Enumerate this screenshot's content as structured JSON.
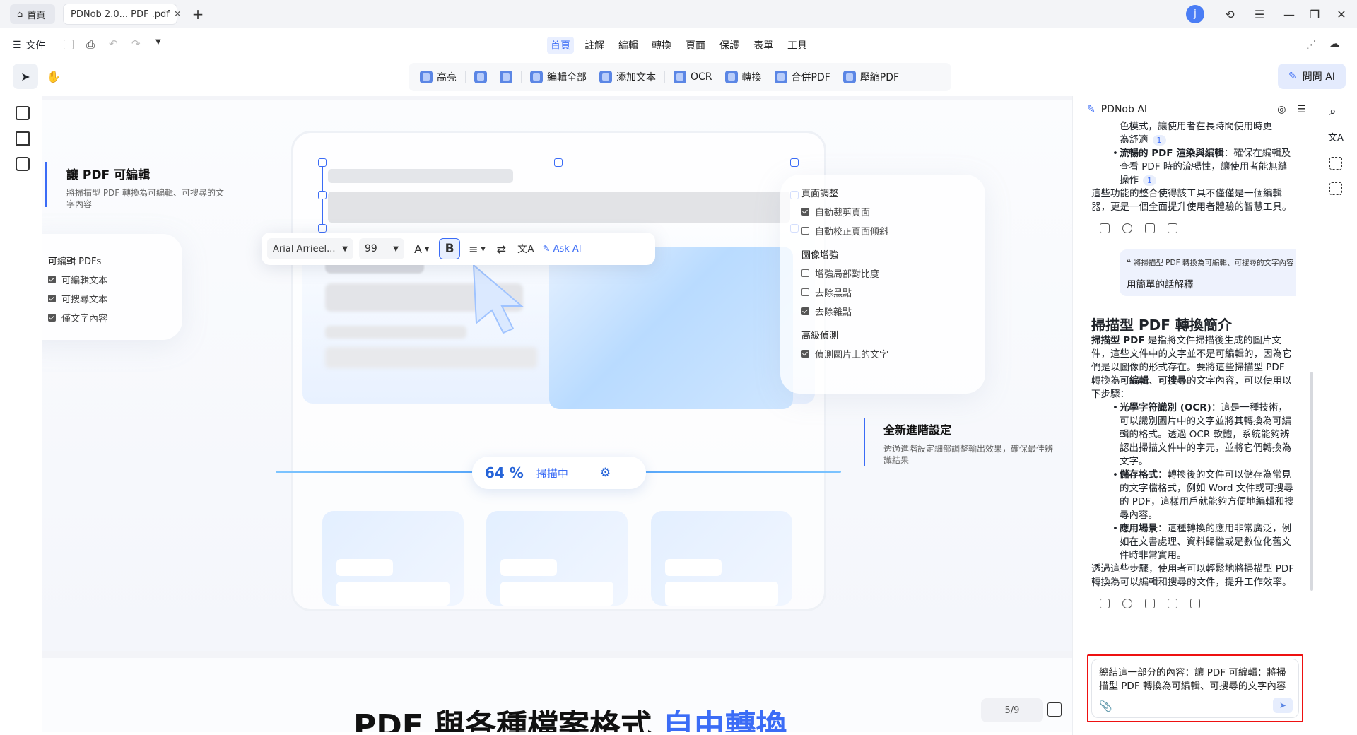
{
  "tabs": {
    "home_label": "首頁",
    "doc_label": "PDNob 2.0... PDF .pdf"
  },
  "window": {
    "avatar_letter": "j"
  },
  "menu": {
    "file_label": "文件",
    "items": [
      "首頁",
      "註解",
      "編輯",
      "轉換",
      "頁面",
      "保護",
      "表單",
      "工具"
    ]
  },
  "toolbar": {
    "tools": [
      "高亮",
      "",
      "",
      "編輯全部",
      "添加文本",
      "OCR",
      "轉換",
      "合併PDF",
      "壓縮PDF"
    ],
    "ask_ai_label": "問問 AI"
  },
  "canvas": {
    "left_title": "讓 PDF 可編輯",
    "left_desc": "將掃描型 PDF 轉換為可編輯、可搜尋的文字內容",
    "editable_card": {
      "title": "可編輯 PDFs",
      "items": [
        "可編輯文本",
        "可搜尋文本",
        "僅文字內容"
      ]
    },
    "settings_card": {
      "section1": "頁面調整",
      "s1_items": [
        "自動裁剪頁面",
        "自動校正頁面傾斜"
      ],
      "s1_checked": [
        true,
        false
      ],
      "section2": "圖像增強",
      "s2_items": [
        "增強局部對比度",
        "去除黑點",
        "去除雜點"
      ],
      "s2_checked": [
        false,
        false,
        true
      ],
      "section3": "高級偵測",
      "s3_items": [
        "偵測圖片上的文字"
      ],
      "s3_checked": [
        true
      ]
    },
    "advanced_title": "全新進階設定",
    "advanced_desc": "透過進階設定細部調整輸出效果，確保最佳辨識結果",
    "scan_percent": "64 %",
    "scan_label": "掃描中",
    "format_bar": {
      "font": "Arial Arrieel...",
      "size": "99",
      "ask_ai": "Ask AI"
    },
    "page2_heading_black": "PDF 與各種檔案格式",
    "page2_heading_blue": "自由轉換",
    "page_indicator": "5/9"
  },
  "ai_panel": {
    "title": "PDNob AI",
    "prev_line1": "色模式，讓使用者在長時間使用時更",
    "prev_line2": "為舒適",
    "prev_ref": "1",
    "prev_bullet_bold": "流暢的 PDF 渲染與編輯",
    "prev_bullet_text": "：確保在編輯及查看 PDF 時的流暢性，讓使用者能無縫操作",
    "prev_bullet_ref": "1",
    "prev_summary": "這些功能的整合使得該工具不僅僅是一個編輯器，更是一個全面提升使用者體驗的智慧工具。",
    "user_quote": "將掃描型 PDF 轉換為可編輯、可搜尋的文字內容",
    "user_message": "用簡單的話解釋",
    "answer_title": "掃描型 PDF 轉換簡介",
    "answer_intro_bold": "掃描型 PDF",
    "answer_intro": " 是指將文件掃描後生成的圖片文件，這些文件中的文字並不是可編輯的，因為它們是以圖像的形式存在。要將這些掃描型 PDF 轉換為",
    "answer_intro_bold2": "可編輯",
    "answer_intro_mid": "、",
    "answer_intro_bold3": "可搜尋",
    "answer_intro_end": "的文字內容，可以使用以下步驟：",
    "bullets": [
      {
        "bold": "光學字符識別 (OCR)",
        "text": "：這是一種技術，可以識別圖片中的文字並將其轉換為可編輯的格式。透過 OCR 軟體，系統能夠辨認出掃描文件中的字元，並將它們轉換為文字。"
      },
      {
        "bold": "儲存格式",
        "text": "：轉換後的文件可以儲存為常見的文字檔格式，例如 Word 文件或可搜尋的 PDF，這樣用戶就能夠方便地編輯和搜尋內容。"
      },
      {
        "bold": "應用場景",
        "text": "：這種轉換的應用非常廣泛，例如在文書處理、資料歸檔或是數位化舊文件時非常實用。"
      }
    ],
    "answer_outro": "透過這些步驟，使用者可以輕鬆地將掃描型 PDF 轉換為可以編輯和搜尋的文件，提升工作效率。",
    "input_text": "總結這一部分的內容：讓 PDF 可編輯：將掃描型 PDF 轉換為可編輯、可搜尋的文字內容"
  }
}
